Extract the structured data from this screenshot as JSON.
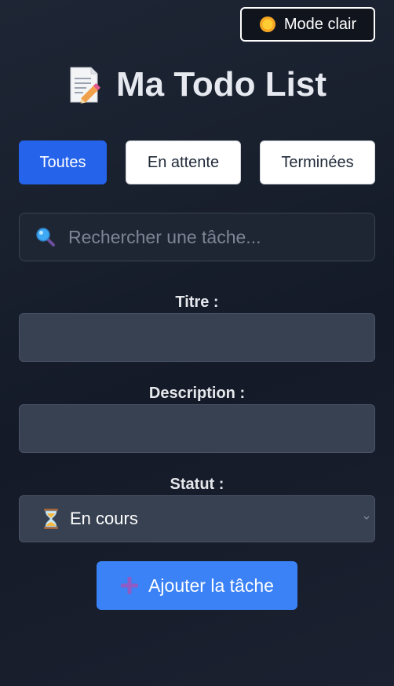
{
  "theme_toggle": {
    "icon": "sun-icon",
    "label": "Mode clair"
  },
  "header": {
    "icon": "memo-icon",
    "title": "Ma Todo List"
  },
  "filters": {
    "all": "Toutes",
    "pending": "En attente",
    "done": "Terminées",
    "active": "Toutes"
  },
  "search": {
    "icon": "search-icon",
    "placeholder": "Rechercher une tâche...",
    "value": ""
  },
  "form": {
    "title_label": "Titre :",
    "title_value": "",
    "description_label": "Description :",
    "description_value": "",
    "status_label": "Statut :",
    "status_icon": "hourglass-icon",
    "status_value": "En cours",
    "submit_icon": "plus-icon",
    "submit_label": "Ajouter la tâche"
  },
  "colors": {
    "accent": "#2563eb",
    "submit": "#3b82f6",
    "input_bg": "#374151",
    "background": "#141a27"
  }
}
